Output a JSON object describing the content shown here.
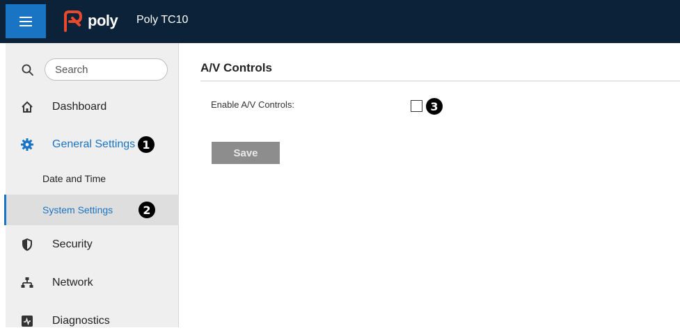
{
  "header": {
    "logo_text": "poly",
    "device_name": "Poly TC10",
    "menu_icon": "hamburger-menu-icon"
  },
  "sidebar": {
    "search": {
      "placeholder": "Search",
      "icon": "search-icon"
    },
    "items": [
      {
        "label": "Dashboard",
        "icon": "home-icon"
      },
      {
        "label": "General Settings",
        "icon": "gear-icon",
        "active": true,
        "callout": "1"
      },
      {
        "label": "Security",
        "icon": "shield-icon"
      },
      {
        "label": "Network",
        "icon": "network-icon"
      },
      {
        "label": "Diagnostics",
        "icon": "diagnostics-icon"
      }
    ],
    "subitems": [
      {
        "label": "Date and Time"
      },
      {
        "label": "System Settings",
        "selected": true,
        "callout": "2"
      }
    ]
  },
  "main": {
    "title": "A/V Controls",
    "field_label": "Enable A/V Controls:",
    "checkbox_checked": false,
    "checkbox_callout": "3",
    "save_label": "Save"
  },
  "colors": {
    "topbar": "#0b2239",
    "accent": "#1a74c4",
    "sidebar_bg": "#efefef",
    "disabled_button": "#8d8d8d"
  }
}
